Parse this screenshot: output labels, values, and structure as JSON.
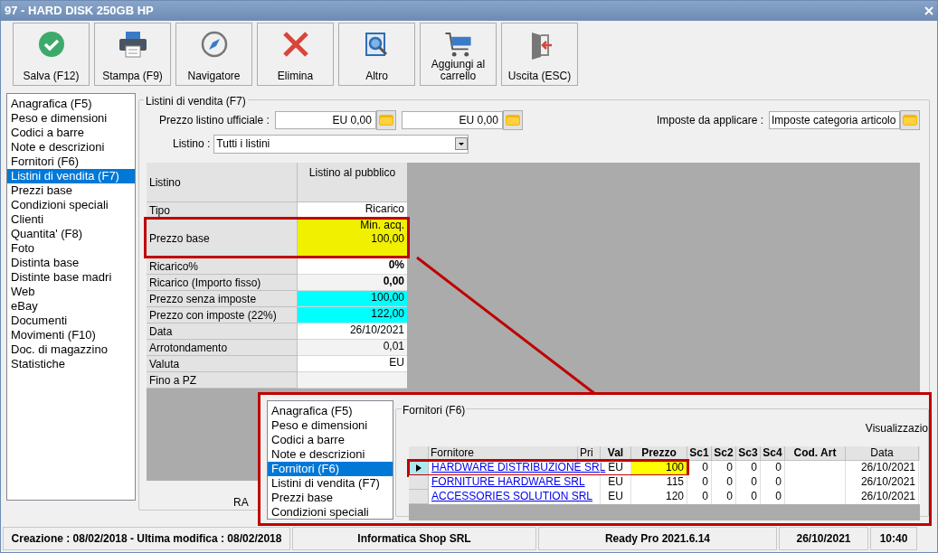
{
  "window": {
    "title": "97 - HARD DISK 250GB HP"
  },
  "toolbar": [
    {
      "kind": "save",
      "label": "Salva (F12)"
    },
    {
      "kind": "print",
      "label": "Stampa (F9)"
    },
    {
      "kind": "navigator",
      "label": "Navigatore"
    },
    {
      "kind": "delete",
      "label": "Elimina"
    },
    {
      "kind": "more",
      "label": "Altro"
    },
    {
      "kind": "cart",
      "label": "Aggiungi al carrello"
    },
    {
      "kind": "exit",
      "label": "Uscita (ESC)"
    }
  ],
  "sidebar": {
    "items": [
      {
        "label": "Anagrafica (F5)",
        "selected": false
      },
      {
        "label": "Peso e dimensioni",
        "selected": false
      },
      {
        "label": "Codici a barre",
        "selected": false
      },
      {
        "label": "Note e descrizioni",
        "selected": false
      },
      {
        "label": "Fornitori (F6)",
        "selected": false
      },
      {
        "label": "Listini di vendita (F7)",
        "selected": true
      },
      {
        "label": "Prezzi base",
        "selected": false
      },
      {
        "label": "Condizioni speciali",
        "selected": false
      },
      {
        "label": "Clienti",
        "selected": false
      },
      {
        "label": "Quantita' (F8)",
        "selected": false
      },
      {
        "label": "Foto",
        "selected": false
      },
      {
        "label": "Distinta base",
        "selected": false
      },
      {
        "label": "Distinte base madri",
        "selected": false
      },
      {
        "label": "Web",
        "selected": false
      },
      {
        "label": "eBay",
        "selected": false
      },
      {
        "label": "Documenti",
        "selected": false
      },
      {
        "label": "Movimenti (F10)",
        "selected": false
      },
      {
        "label": "Doc. di magazzino",
        "selected": false
      },
      {
        "label": "Statistiche",
        "selected": false
      }
    ]
  },
  "panel": {
    "title": "Listini di vendita (F7)",
    "official_price": {
      "label": "Prezzo listino ufficiale :",
      "values": [
        "EU 0,00",
        "EU 0,00"
      ]
    },
    "taxes": {
      "label": "Imposte da applicare :",
      "value": "Imposte categoria articolo"
    },
    "listino": {
      "label": "Listino :",
      "value": "Tutti i listini"
    },
    "grid": {
      "header": {
        "label": "Listino",
        "column": "Listino al pubblico"
      },
      "rows": [
        {
          "label": "Tipo",
          "values": [
            "Ricarico"
          ],
          "bold": false
        },
        {
          "label": "Prezzo base",
          "values": [
            "Min. acq.",
            "100,00"
          ],
          "bold": false,
          "color": "#f0f000",
          "highlighted": true
        },
        {
          "label": "Ricarico%",
          "values": [
            "0%"
          ],
          "bold": true
        },
        {
          "label": "Ricarico (Importo fisso)",
          "values": [
            "0,00"
          ],
          "bold": true
        },
        {
          "label": "Prezzo senza imposte",
          "values": [
            "100,00"
          ],
          "bold": false,
          "color": "#00ffff"
        },
        {
          "label": "Prezzo con imposte (22%)",
          "values": [
            "122,00"
          ],
          "bold": false,
          "color": "#00ffff"
        },
        {
          "label": "Data",
          "values": [
            "26/10/2021"
          ],
          "bold": false
        },
        {
          "label": "Arrotondamento",
          "values": [
            "0,01"
          ],
          "bold": false
        },
        {
          "label": "Valuta",
          "values": [
            "EU"
          ],
          "bold": false
        },
        {
          "label": "Fino a PZ",
          "values": []
        }
      ]
    },
    "partial_label": "RA"
  },
  "inset": {
    "sidebar": {
      "items": [
        {
          "label": "Anagrafica (F5)",
          "selected": false
        },
        {
          "label": "Peso e dimensioni",
          "selected": false
        },
        {
          "label": "Codici a barre",
          "selected": false
        },
        {
          "label": "Note e descrizioni",
          "selected": false
        },
        {
          "label": "Fornitori (F6)",
          "selected": true
        },
        {
          "label": "Listini di vendita (F7)",
          "selected": false
        },
        {
          "label": "Prezzi base",
          "selected": false
        },
        {
          "label": "Condizioni speciali",
          "selected": false
        }
      ]
    },
    "group_title": "Fornitori (F6)",
    "view_label": "Visualizzazio",
    "table": {
      "columns": [
        "Fornitore",
        "Pri",
        "Val",
        "Prezzo",
        "Sc1",
        "Sc2",
        "Sc3",
        "Sc4",
        "Cod. Art",
        "Data"
      ],
      "rows": [
        {
          "selected": true,
          "highlighted": true,
          "cells": [
            "HARDWARE DISTRIBUZIONE SRL",
            "",
            "EU",
            "100",
            "0",
            "0",
            "0",
            "0",
            "",
            "26/10/2021"
          ]
        },
        {
          "selected": false,
          "highlighted": false,
          "cells": [
            "FORNITURE HARDWARE SRL",
            "",
            "EU",
            "115",
            "0",
            "0",
            "0",
            "0",
            "",
            "26/10/2021"
          ]
        },
        {
          "selected": false,
          "highlighted": false,
          "cells": [
            "ACCESSORIES SOLUTION SRL",
            "",
            "EU",
            "120",
            "0",
            "0",
            "0",
            "0",
            "",
            "26/10/2021"
          ]
        }
      ]
    }
  },
  "status_bar": [
    "Creazione : 08/02/2018 - Ultima modifica : 08/02/2018",
    "Informatica Shop SRL",
    "Ready Pro 2021.6.14",
    "26/10/2021",
    "10:40"
  ]
}
